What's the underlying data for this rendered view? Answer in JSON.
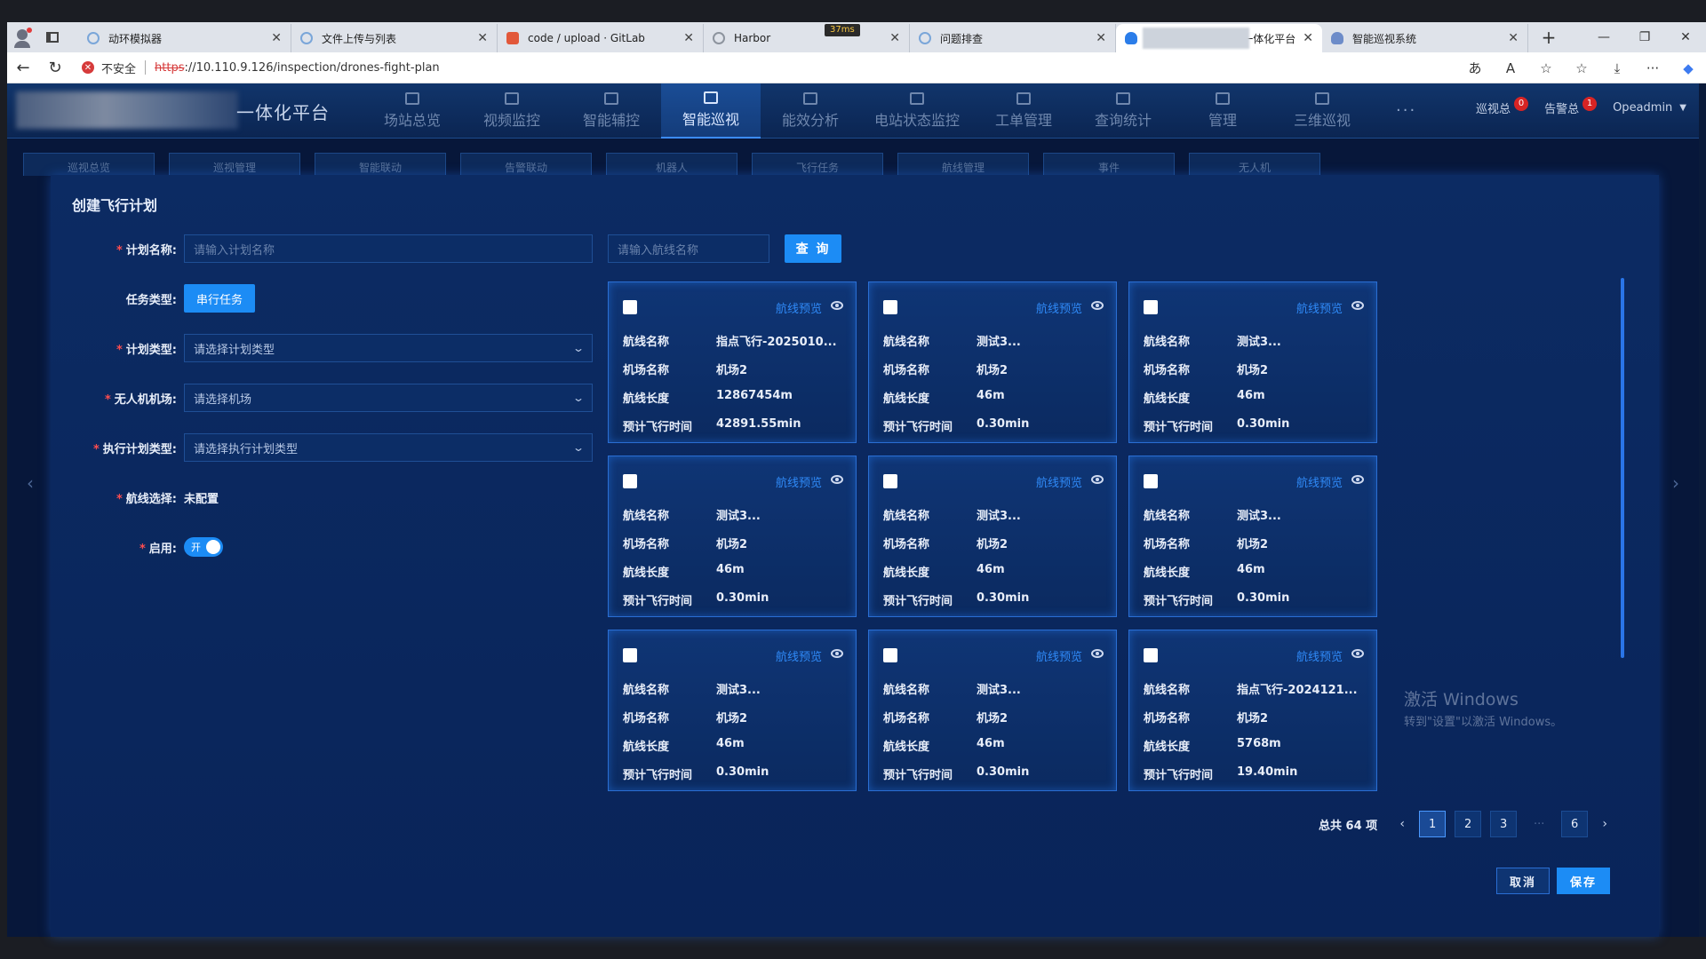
{
  "browser": {
    "tabs": [
      {
        "label": "动环模拟器",
        "icon": "swirl"
      },
      {
        "label": "文件上传与列表",
        "icon": "swirl"
      },
      {
        "label": "code / upload · GitLab",
        "icon": "fox"
      },
      {
        "label": "Harbor",
        "icon": "harbor"
      },
      {
        "label": "问题排查",
        "icon": "swirl"
      },
      {
        "label": "一体化平台",
        "icon": "cloud"
      },
      {
        "label": "智能巡视系统",
        "icon": "cloud2"
      }
    ],
    "netspeed": "37ms",
    "security_label": "不安全",
    "url_protocol": "https",
    "url_rest": "://10.110.9.126/inspection/drones-fight-plan"
  },
  "header": {
    "title": "一体化平台",
    "nav": [
      "场站总览",
      "视频监控",
      "智能辅控",
      "智能巡视",
      "能效分析",
      "电站状态监控",
      "工单管理",
      "查询统计",
      "管理",
      "三维巡视"
    ],
    "active_nav": "智能巡视",
    "more": "···",
    "inspect_label": "巡视总",
    "inspect_count": "0",
    "alarm_label": "告警总",
    "alarm_count": "1",
    "user": "Opeadmin"
  },
  "subnav": [
    "巡视总览",
    "巡视管理",
    "智能联动",
    "告警联动",
    "机器人",
    "飞行任务",
    "航线管理",
    "事件",
    "无人机"
  ],
  "modal": {
    "title": "创建飞行计划",
    "form": {
      "plan_name_label": "计划名称:",
      "plan_name_placeholder": "请输入计划名称",
      "task_type_label": "任务类型:",
      "task_type_value": "串行任务",
      "plan_type_label": "计划类型:",
      "plan_type_placeholder": "请选择计划类型",
      "airport_label": "无人机机场:",
      "airport_placeholder": "请选择机场",
      "exec_type_label": "执行计划类型:",
      "exec_type_placeholder": "请选择执行计划类型",
      "route_select_label": "航线选择:",
      "route_select_value": "未配置",
      "enable_label": "启用:",
      "enable_value": "开"
    },
    "route_search_placeholder": "请输入航线名称",
    "query_button": "查 询",
    "card_keys": {
      "name": "航线名称",
      "airport": "机场名称",
      "length": "航线长度",
      "time": "预计飞行时间"
    },
    "preview_label": "航线预览",
    "cards": [
      {
        "name": "指点飞行-2025010...",
        "airport": "机场2",
        "length": "12867454m",
        "time": "42891.55min"
      },
      {
        "name": "测试3...",
        "airport": "机场2",
        "length": "46m",
        "time": "0.30min"
      },
      {
        "name": "测试3...",
        "airport": "机场2",
        "length": "46m",
        "time": "0.30min"
      },
      {
        "name": "测试3...",
        "airport": "机场2",
        "length": "46m",
        "time": "0.30min"
      },
      {
        "name": "测试3...",
        "airport": "机场2",
        "length": "46m",
        "time": "0.30min"
      },
      {
        "name": "测试3...",
        "airport": "机场2",
        "length": "46m",
        "time": "0.30min"
      },
      {
        "name": "测试3...",
        "airport": "机场2",
        "length": "46m",
        "time": "0.30min"
      },
      {
        "name": "测试3...",
        "airport": "机场2",
        "length": "46m",
        "time": "0.30min"
      },
      {
        "name": "指点飞行-2024121...",
        "airport": "机场2",
        "length": "5768m",
        "time": "19.40min"
      }
    ],
    "pager": {
      "total": "总共 64 项",
      "pages": [
        "1",
        "2",
        "3",
        "6"
      ],
      "active": "1",
      "ellipsis": "···"
    },
    "cancel": "取消",
    "save": "保存"
  },
  "watermark": {
    "line1": "激活 Windows",
    "line2": "转到\"设置\"以激活 Windows。"
  }
}
